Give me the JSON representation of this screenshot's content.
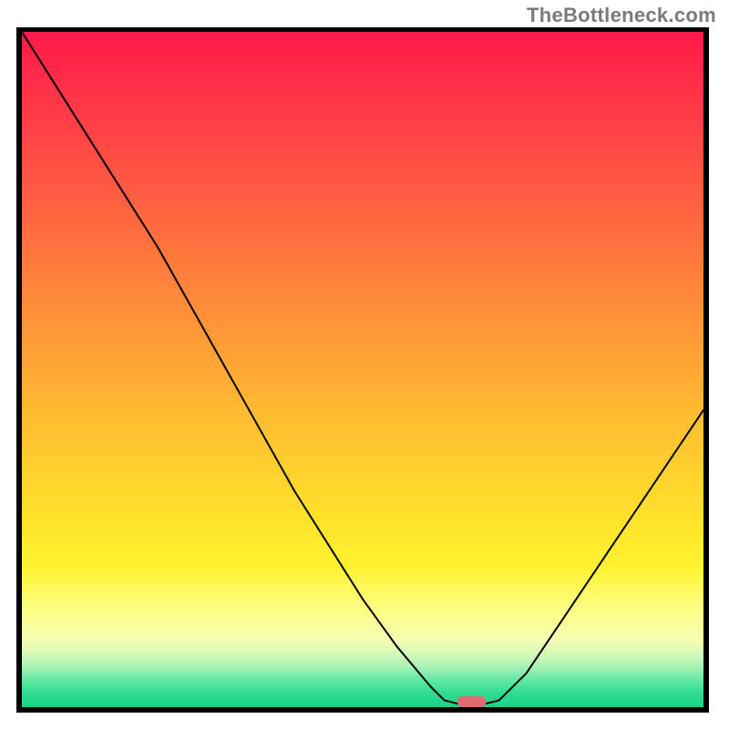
{
  "watermark": "TheBottleneck.com",
  "colors": {
    "border": "#000000",
    "marker": "#e06a6f",
    "gradient_top": "#ff1a49",
    "gradient_mid": "#ffe22a",
    "gradient_bottom": "#1ad387",
    "curve": "#000000"
  },
  "chart_data": {
    "type": "line",
    "title": "",
    "xlabel": "",
    "ylabel": "",
    "xlim": [
      0,
      100
    ],
    "ylim": [
      0,
      100
    ],
    "note": "Axes carry no tick labels in the source image. Values below are read off as percentages of the plotting area (x from left, y from bottom). Curve shape: steep descent from top-left with a slope break near x≈20, reaches a flat floor at y≈0 around x≈62–70 where a pink marker sits, then rises roughly linearly to about y≈44 at the right edge.",
    "x": [
      0,
      5,
      10,
      15,
      20,
      25,
      30,
      35,
      40,
      45,
      50,
      55,
      60,
      62,
      66,
      70,
      74,
      80,
      86,
      92,
      98,
      100
    ],
    "y": [
      100,
      92,
      84,
      76,
      68,
      59,
      50,
      41,
      32,
      24,
      16,
      9,
      3,
      1,
      0,
      1,
      5,
      14,
      23,
      32,
      41,
      44
    ],
    "marker": {
      "x": 66,
      "y": 0,
      "label": ""
    }
  }
}
